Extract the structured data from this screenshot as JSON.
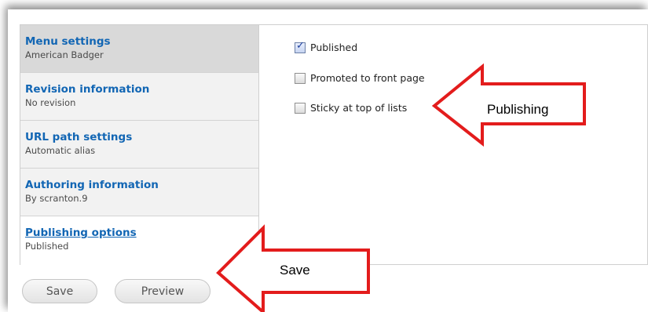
{
  "vertical_tabs": [
    {
      "title": "Menu settings",
      "summary": "American Badger"
    },
    {
      "title": "Revision information",
      "summary": "No revision"
    },
    {
      "title": "URL path settings",
      "summary": "Automatic alias"
    },
    {
      "title": "Authoring information",
      "summary": "By scranton.9"
    },
    {
      "title": "Publishing options",
      "summary": "Published"
    }
  ],
  "publishing_pane": {
    "options": [
      {
        "label": "Published",
        "checked": true
      },
      {
        "label": "Promoted to front page",
        "checked": false
      },
      {
        "label": "Sticky at top of lists",
        "checked": false
      }
    ]
  },
  "actions": {
    "save_label": "Save",
    "preview_label": "Preview"
  },
  "annotations": {
    "publishing_label": "Publishing",
    "save_label": "Save",
    "arrow_color": "#e31c1c"
  }
}
